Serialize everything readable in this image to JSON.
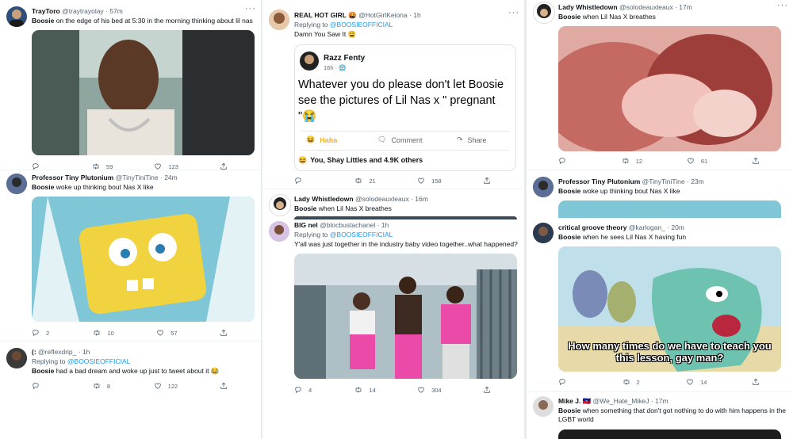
{
  "col1": {
    "t1": {
      "name": "TrayToro",
      "handle": "@traytrayolay",
      "time": "· 57m",
      "text_bold": "Boosie",
      "text": " on the edge of his bed at 5:30 in the morning thinking about lil nas",
      "replies": "",
      "retweets": "59",
      "likes": "123"
    },
    "t2": {
      "name": "Professor Tiny Plutonium",
      "handle": "@TinyTiniTine",
      "time": "· 24m",
      "text_bold": "Boosie",
      "text": " woke up thinking bout Nas X like",
      "replies": "2",
      "retweets": "10",
      "likes": "57"
    },
    "t3": {
      "name": "(:",
      "handle": "@reflexdrip_",
      "time": "· 1h",
      "replying_prefix": "Replying to ",
      "replying_to": "@BOOSIEOFFICIAL",
      "text_bold": "Boosie",
      "text": " had a bad dream and woke up just to tweet about it 😂",
      "replies": "",
      "retweets": "8",
      "likes": "122"
    }
  },
  "col2": {
    "t1": {
      "name": "REAL HOT GIRL 🤬",
      "handle": "@HotGirlKeiona",
      "time": "· 1h",
      "replying_prefix": "Replying to ",
      "replying_to": "@BOOSIEOFFICIAL",
      "text": "Damn You Saw It 😩",
      "replies": "",
      "retweets": "21",
      "likes": "158"
    },
    "fb": {
      "name": "Razz Fenty",
      "time": "16h · 🌐",
      "text": "Whatever you do please don't let Boosie see the pictures of Lil Nas x \" pregnant \"😭",
      "reaction": "Haha",
      "comment": "Comment",
      "share": "Share",
      "reactors": "You, Shay Littles and 4.9K others"
    },
    "t2": {
      "name": "Lady Whistledown",
      "handle": "@solodeauxleaux",
      "time": "· 16m",
      "text_bold": "Boosie",
      "text": " when Lil Nas X breathes"
    },
    "t3": {
      "name": "BIG nel",
      "handle": "@blocbustachanel",
      "time": "· 1h",
      "replying_prefix": "Replying to ",
      "replying_to": "@BOOSIEOFFICIAL",
      "text": "Y'all was just together in the industry baby video together..what happened?",
      "replies": "4",
      "retweets": "14",
      "likes": "304"
    }
  },
  "col3": {
    "t1": {
      "name": "Lady Whistledown",
      "handle": "@solodeauxleaux",
      "time": "· 17m",
      "text_bold": "Boosie",
      "text": " when Lil Nas X breathes",
      "replies": "",
      "retweets": "12",
      "likes": "61"
    },
    "t2": {
      "name": "Professor Tiny Plutonium",
      "handle": "@TinyTiniTine",
      "time": "· 23m",
      "text_bold": "Boosie",
      "text": " woke up thinking bout Nas X like"
    },
    "t3": {
      "name": "critical groove theory",
      "handle": "@karlogan_",
      "time": "· 20m",
      "text_bold": "Boosie",
      "text": " when he sees Lil Nas X having fun",
      "caption": "How many times do we have to teach you this lesson, gay man?",
      "replies": "",
      "retweets": "2",
      "likes": "14"
    },
    "t4": {
      "name": "Mike J. 🇭🇹",
      "handle": "@We_Hate_MikeJ",
      "time": "· 17m",
      "text_bold": "Boosie",
      "text": " when something that don't got nothing to do with him happens in the LGBT world"
    }
  },
  "icons": {
    "reply": "reply-icon",
    "retweet": "retweet-icon",
    "like": "heart-icon",
    "share": "share-icon",
    "more": "more-icon"
  },
  "colors": {
    "link": "#1d9bf0",
    "muted": "#536471",
    "haha": "#f7b125"
  }
}
